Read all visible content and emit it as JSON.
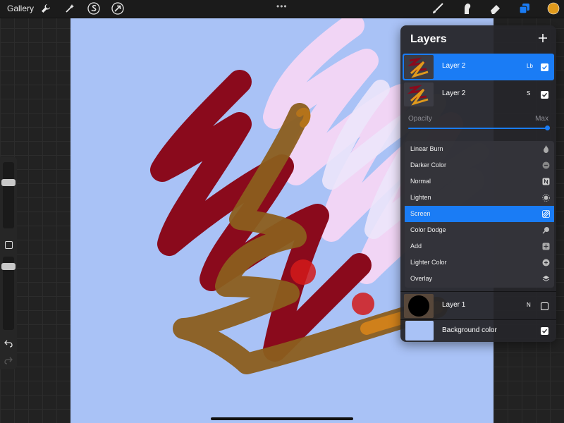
{
  "topbar": {
    "gallery_label": "Gallery",
    "left_tools": [
      "wrench-icon",
      "magic-wand-icon",
      "selection-icon",
      "transform-arrow-icon"
    ],
    "center_handle": "•••",
    "right_tools": [
      "brush-icon",
      "smudge-icon",
      "eraser-icon",
      "layers-icon",
      "color-swatch"
    ],
    "color_swatch": "#e09a1c",
    "accent": "#1a7cf5"
  },
  "canvas": {
    "background": "#a9c2f6"
  },
  "layers_panel": {
    "title": "Layers",
    "layers": [
      {
        "name": "Layer 2",
        "mode": "Lb",
        "visible": true,
        "selected": true
      },
      {
        "name": "Layer 2",
        "mode": "S",
        "visible": true,
        "selected": false
      }
    ],
    "opacity": {
      "label": "Opacity",
      "value_label": "Max",
      "value": 1.0
    },
    "blend_modes": [
      {
        "label": "Linear Burn",
        "icon": "flame-icon"
      },
      {
        "label": "Darker Color",
        "icon": "minus-circle-icon"
      },
      {
        "label": "Normal",
        "icon": "n-square-icon"
      },
      {
        "label": "Lighten",
        "icon": "sun-icon"
      },
      {
        "label": "Screen",
        "icon": "hatch-square-icon",
        "active": true
      },
      {
        "label": "Color Dodge",
        "icon": "magnifier-icon"
      },
      {
        "label": "Add",
        "icon": "plus-square-icon"
      },
      {
        "label": "Lighter Color",
        "icon": "plus-circle-icon"
      },
      {
        "label": "Overlay",
        "icon": "layers-stack-icon"
      }
    ],
    "lower_layers": [
      {
        "name": "Layer 1",
        "mode": "N",
        "visible": false
      },
      {
        "name": "Background color",
        "visible": true
      }
    ]
  }
}
